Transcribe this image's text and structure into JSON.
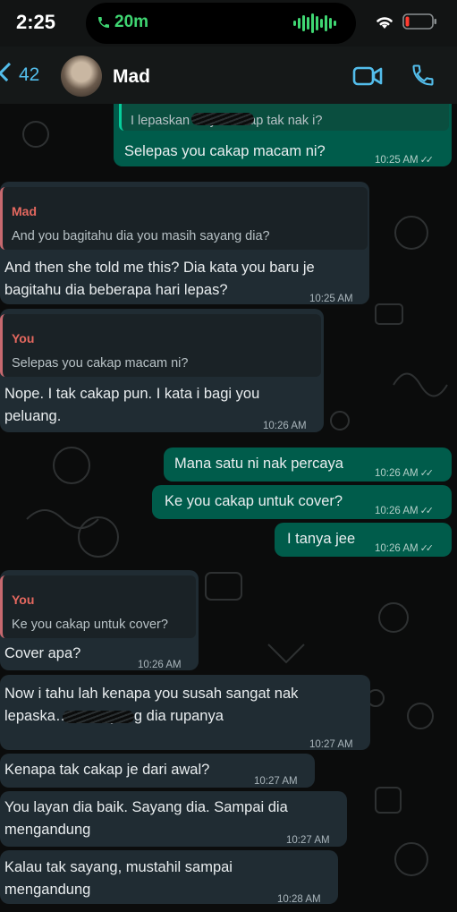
{
  "status_bar": {
    "time": "2:25",
    "call_duration": "20m"
  },
  "header": {
    "back_count": "42",
    "contact_name": "Mad"
  },
  "messages": [
    {
      "dir": "out",
      "quote_partial": "I lepaskan … you tetap tak nak i?",
      "text": "Selepas you cakap macam ni?",
      "time": "10:25 AM"
    },
    {
      "dir": "in",
      "quote_author": "Mad",
      "quote": "And you bagitahu dia you masih sayang dia?",
      "lines": [
        "And then she told me this? Dia kata you baru je",
        "bagitahu dia beberapa hari lepas?"
      ],
      "time": "10:25 AM"
    },
    {
      "dir": "in",
      "quote_author": "You",
      "quote": "Selepas you cakap macam ni?",
      "lines": [
        "Nope. I tak cakap pun. I kata i bagi you",
        "peluang."
      ],
      "time": "10:26 AM"
    },
    {
      "dir": "out",
      "text": "Mana satu ni nak percaya",
      "time": "10:26 AM"
    },
    {
      "dir": "out",
      "text": "Ke you cakap untuk cover?",
      "time": "10:26 AM"
    },
    {
      "dir": "out",
      "text": "I tanya jee",
      "time": "10:26 AM"
    },
    {
      "dir": "in",
      "quote_author": "You",
      "quote": "Ke you cakap untuk cover?",
      "text": "Cover apa?",
      "time": "10:26 AM"
    },
    {
      "dir": "in",
      "lines": [
        "Now i tahu lah kenapa you susah sangat nak",
        "lepaska…    ou sayang dia rupanya"
      ],
      "time": "10:27 AM"
    },
    {
      "dir": "in",
      "text": "Kenapa tak cakap je dari awal?",
      "time": "10:27 AM"
    },
    {
      "dir": "in",
      "lines": [
        "You layan dia baik. Sayang dia. Sampai dia",
        "mengandung"
      ],
      "time": "10:27 AM"
    },
    {
      "dir": "in",
      "lines": [
        "Kalau tak sayang, mustahil sampai",
        "mengandung"
      ],
      "time": "10:28 AM"
    }
  ],
  "colors": {
    "incoming": "#202c33",
    "outgoing": "#005c4b",
    "accent_blue": "#53bdeb",
    "call_green": "#3fd672"
  }
}
